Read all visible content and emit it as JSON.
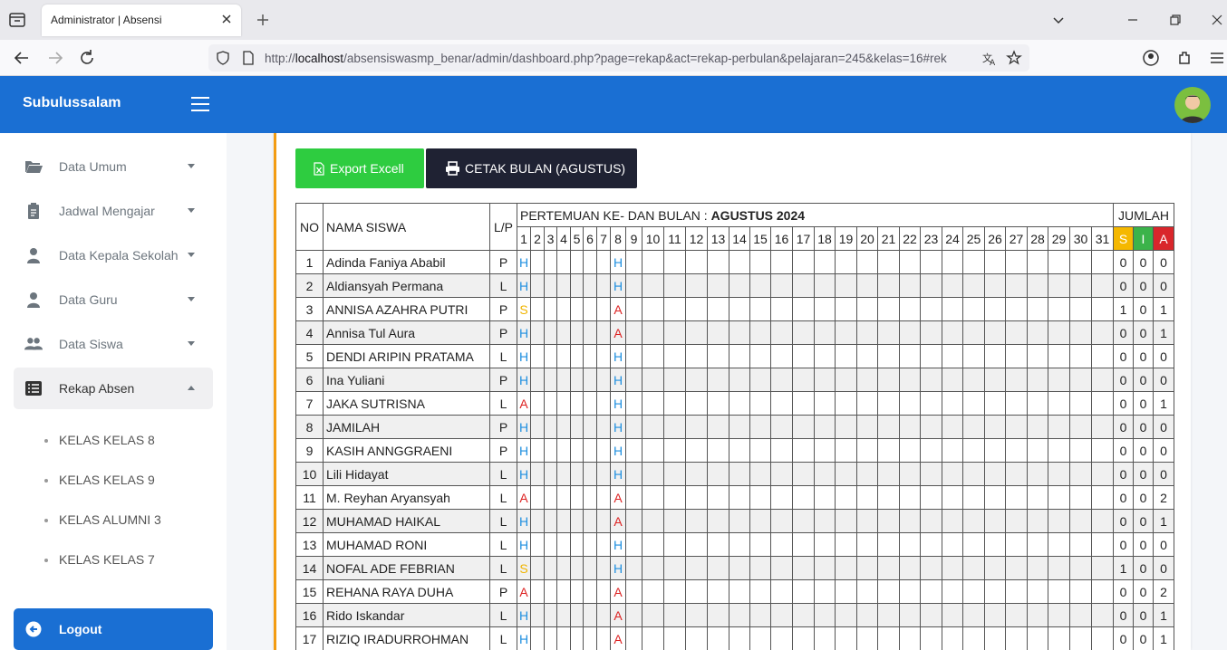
{
  "browser": {
    "tab_title": "Administrator | Absensi",
    "url_prefix": "http://",
    "url_host": "localhost",
    "url_path": "/absensiswasmp_benar/admin/dashboard.php?page=rekap&act=rekap-perbulan&pelajaran=245&kelas=16#rek"
  },
  "app": {
    "brand": "Subulussalam"
  },
  "sidebar": {
    "items": [
      {
        "label": "Data Umum"
      },
      {
        "label": "Jadwal Mengajar"
      },
      {
        "label": "Data Kepala Sekolah"
      },
      {
        "label": "Data Guru"
      },
      {
        "label": "Data Siswa"
      },
      {
        "label": "Rekap Absen"
      }
    ],
    "subitems": [
      {
        "label": "KELAS KELAS 8"
      },
      {
        "label": "KELAS KELAS 9"
      },
      {
        "label": "KELAS ALUMNI 3"
      },
      {
        "label": "KELAS KELAS 7"
      }
    ],
    "logout": "Logout"
  },
  "actions": {
    "export": "Export Excell",
    "print": "CETAK BULAN (AGUSTUS)"
  },
  "table": {
    "h_no": "NO",
    "h_name": "NAMA SISWA",
    "h_lp": "L/P",
    "h_period_prefix": "PERTEMUAN KE- DAN BULAN : ",
    "h_period_month": "AGUSTUS 2024",
    "h_total": "JUMLAH",
    "h_s": "S",
    "h_i": "I",
    "h_a": "A",
    "days": 31,
    "rows": [
      {
        "no": "1",
        "name": "Adinda Faniya Ababil",
        "lp": "P",
        "marks": {
          "1": "H",
          "8": "H"
        },
        "s": "0",
        "i": "0",
        "a": "0"
      },
      {
        "no": "2",
        "name": "Aldiansyah Permana",
        "lp": "L",
        "marks": {
          "1": "H",
          "8": "H"
        },
        "s": "0",
        "i": "0",
        "a": "0"
      },
      {
        "no": "3",
        "name": "ANNISA AZAHRA PUTRI",
        "lp": "P",
        "marks": {
          "1": "S",
          "8": "A"
        },
        "s": "1",
        "i": "0",
        "a": "1"
      },
      {
        "no": "4",
        "name": "Annisa Tul Aura",
        "lp": "P",
        "marks": {
          "1": "H",
          "8": "A"
        },
        "s": "0",
        "i": "0",
        "a": "1"
      },
      {
        "no": "5",
        "name": "DENDI ARIPIN PRATAMA",
        "lp": "L",
        "marks": {
          "1": "H",
          "8": "H"
        },
        "s": "0",
        "i": "0",
        "a": "0"
      },
      {
        "no": "6",
        "name": "Ina Yuliani",
        "lp": "P",
        "marks": {
          "1": "H",
          "8": "H"
        },
        "s": "0",
        "i": "0",
        "a": "0"
      },
      {
        "no": "7",
        "name": "JAKA SUTRISNA",
        "lp": "L",
        "marks": {
          "1": "A",
          "8": "H"
        },
        "s": "0",
        "i": "0",
        "a": "1"
      },
      {
        "no": "8",
        "name": "JAMILAH",
        "lp": "P",
        "marks": {
          "1": "H",
          "8": "H"
        },
        "s": "0",
        "i": "0",
        "a": "0"
      },
      {
        "no": "9",
        "name": "KASIH ANNGGRAENI",
        "lp": "P",
        "marks": {
          "1": "H",
          "8": "H"
        },
        "s": "0",
        "i": "0",
        "a": "0"
      },
      {
        "no": "10",
        "name": "Lili Hidayat",
        "lp": "L",
        "marks": {
          "1": "H",
          "8": "H"
        },
        "s": "0",
        "i": "0",
        "a": "0"
      },
      {
        "no": "11",
        "name": "M. Reyhan Aryansyah",
        "lp": "L",
        "marks": {
          "1": "A",
          "8": "A"
        },
        "s": "0",
        "i": "0",
        "a": "2"
      },
      {
        "no": "12",
        "name": "MUHAMAD HAIKAL",
        "lp": "L",
        "marks": {
          "1": "H",
          "8": "A"
        },
        "s": "0",
        "i": "0",
        "a": "1"
      },
      {
        "no": "13",
        "name": "MUHAMAD RONI",
        "lp": "L",
        "marks": {
          "1": "H",
          "8": "H"
        },
        "s": "0",
        "i": "0",
        "a": "0"
      },
      {
        "no": "14",
        "name": "NOFAL ADE FEBRIAN",
        "lp": "L",
        "marks": {
          "1": "S",
          "8": "H"
        },
        "s": "1",
        "i": "0",
        "a": "0"
      },
      {
        "no": "15",
        "name": "REHANA RAYA DUHA",
        "lp": "P",
        "marks": {
          "1": "A",
          "8": "A"
        },
        "s": "0",
        "i": "0",
        "a": "2"
      },
      {
        "no": "16",
        "name": "Rido Iskandar",
        "lp": "L",
        "marks": {
          "1": "H",
          "8": "A"
        },
        "s": "0",
        "i": "0",
        "a": "1"
      },
      {
        "no": "17",
        "name": "RIZIQ IRADURROHMAN",
        "lp": "L",
        "marks": {
          "1": "H",
          "8": "A"
        },
        "s": "0",
        "i": "0",
        "a": "1"
      }
    ]
  }
}
